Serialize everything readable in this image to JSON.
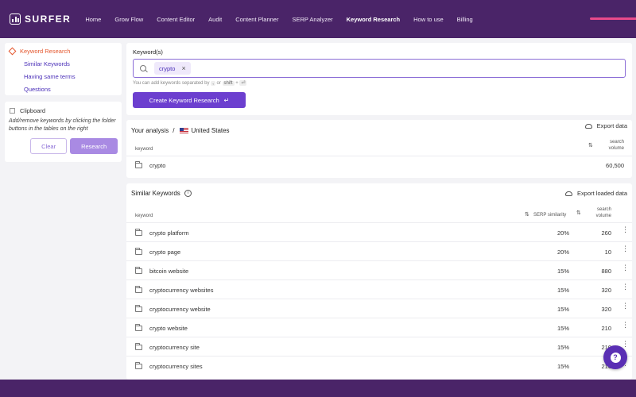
{
  "app": {
    "logo_text": "SURFER"
  },
  "nav": {
    "items": [
      "Home",
      "Grow Flow",
      "Content Editor",
      "Audit",
      "Content Planner",
      "SERP Analyzer",
      "Keyword Research",
      "How to use",
      "Billing"
    ],
    "active": "Keyword Research"
  },
  "sidebar": {
    "header": "Keyword Research",
    "links": [
      "Similar Keywords",
      "Having same terms",
      "Questions"
    ]
  },
  "clipboard": {
    "title": "Clipboard",
    "description": "Add/remove keywords by clicking the folder buttons in the tables on the right",
    "clear_label": "Clear",
    "research_label": "Research"
  },
  "keywords": {
    "label": "Keyword(s)",
    "chip": "crypto",
    "hint_prefix": "You can add keywords separated by",
    "hint_key1": ",",
    "hint_or": "or",
    "hint_key2": "shift",
    "hint_plus": "+",
    "hint_key3": "⏎",
    "create_label": "Create Keyword Research",
    "create_icon": "↵"
  },
  "analysis": {
    "title": "Your analysis",
    "separator": "/",
    "country": "United States",
    "export_label": "Export data",
    "col_keyword": "keyword",
    "col_volume_1": "search",
    "col_volume_2": "volume",
    "row": {
      "keyword": "crypto",
      "volume": "60,500"
    }
  },
  "similar": {
    "title": "Similar Keywords",
    "export_label": "Export loaded data",
    "col_keyword": "keyword",
    "col_similarity": "SERP similarity",
    "col_volume_1": "search",
    "col_volume_2": "volume",
    "rows": [
      {
        "keyword": "crypto platform",
        "similarity": "20%",
        "volume": "260"
      },
      {
        "keyword": "crypto page",
        "similarity": "20%",
        "volume": "10"
      },
      {
        "keyword": "bitcoin website",
        "similarity": "15%",
        "volume": "880"
      },
      {
        "keyword": "cryptocurrency websites",
        "similarity": "15%",
        "volume": "320"
      },
      {
        "keyword": "cryptocurrency website",
        "similarity": "15%",
        "volume": "320"
      },
      {
        "keyword": "crypto website",
        "similarity": "15%",
        "volume": "210"
      },
      {
        "keyword": "cryptocurrency site",
        "similarity": "15%",
        "volume": "210"
      },
      {
        "keyword": "cryptocurrency sites",
        "similarity": "15%",
        "volume": "210"
      }
    ]
  },
  "help": {
    "label": "?"
  },
  "colors": {
    "brand": "#4a2468",
    "accent": "#6c3fcf",
    "highlight": "#e4572e"
  }
}
